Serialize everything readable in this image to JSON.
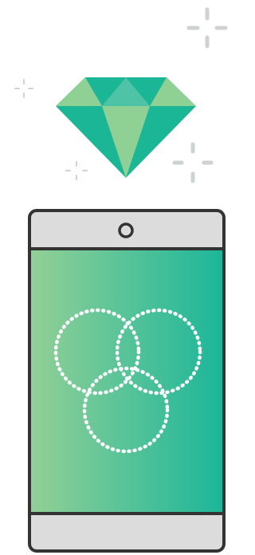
{
  "illustration": {
    "subject": "phone-with-diamond",
    "icons": [
      "sparkle-icon",
      "diamond-icon",
      "smartphone-icon",
      "camera-icon",
      "overlapping-circles-icon"
    ],
    "colors": {
      "sparkle": "#cfd2d4",
      "diamond_dark": "#1bb696",
      "diamond_light": "#8fd095",
      "diamond_mid": "#4fc3a6",
      "phone_outline": "#333333",
      "phone_body": "#dcdcdc",
      "screen_gradient_start": "#93d096",
      "screen_gradient_end": "#1bb69a",
      "circle_stroke": "#ffffff"
    }
  }
}
